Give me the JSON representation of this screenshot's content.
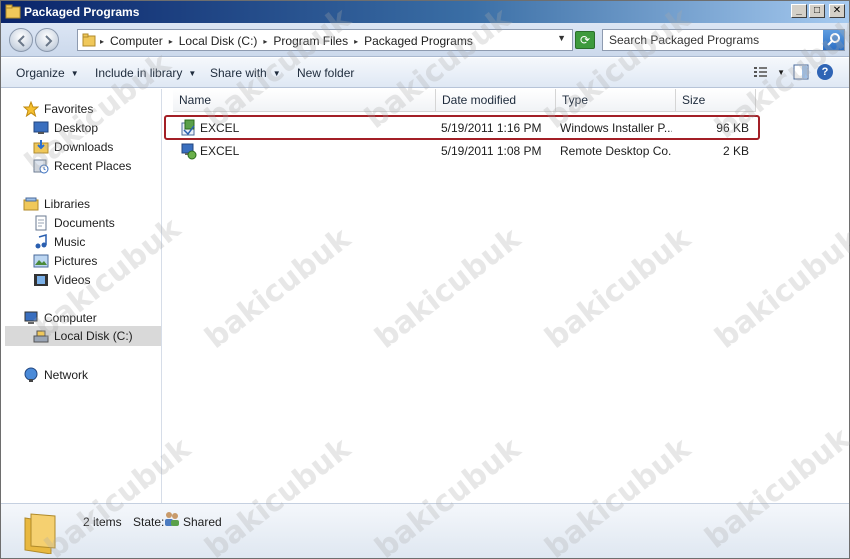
{
  "window": {
    "title": "Packaged Programs"
  },
  "address": {
    "crumbs": [
      "Computer",
      "Local Disk (C:)",
      "Program Files",
      "Packaged Programs"
    ]
  },
  "search": {
    "placeholder": "Search Packaged Programs"
  },
  "toolbar": {
    "organize": "Organize",
    "include_in_library": "Include in library",
    "share_with": "Share with",
    "new_folder": "New folder"
  },
  "nav": {
    "favorites": "Favorites",
    "desktop": "Desktop",
    "downloads": "Downloads",
    "recent_places": "Recent Places",
    "libraries": "Libraries",
    "documents": "Documents",
    "music": "Music",
    "pictures": "Pictures",
    "videos": "Videos",
    "computer": "Computer",
    "local_disk": "Local Disk (C:)",
    "network": "Network"
  },
  "columns": {
    "name": "Name",
    "date_modified": "Date modified",
    "type": "Type",
    "size": "Size"
  },
  "files": [
    {
      "name": "EXCEL",
      "date": "5/19/2011 1:16 PM",
      "type": "Windows Installer P...",
      "size": "96 KB",
      "icon": "installer-package-icon"
    },
    {
      "name": "EXCEL",
      "date": "5/19/2011 1:08 PM",
      "type": "Remote Desktop Co...",
      "size": "2 KB",
      "icon": "remote-desktop-icon"
    }
  ],
  "details": {
    "count": "2 items",
    "state_label": "State:",
    "state_value": "Shared"
  },
  "watermark": "bakicubuk",
  "colors": {
    "title_bar": "#0a246a",
    "highlight_border": "#a31f26",
    "selected_nav": "#d9d9d9"
  }
}
